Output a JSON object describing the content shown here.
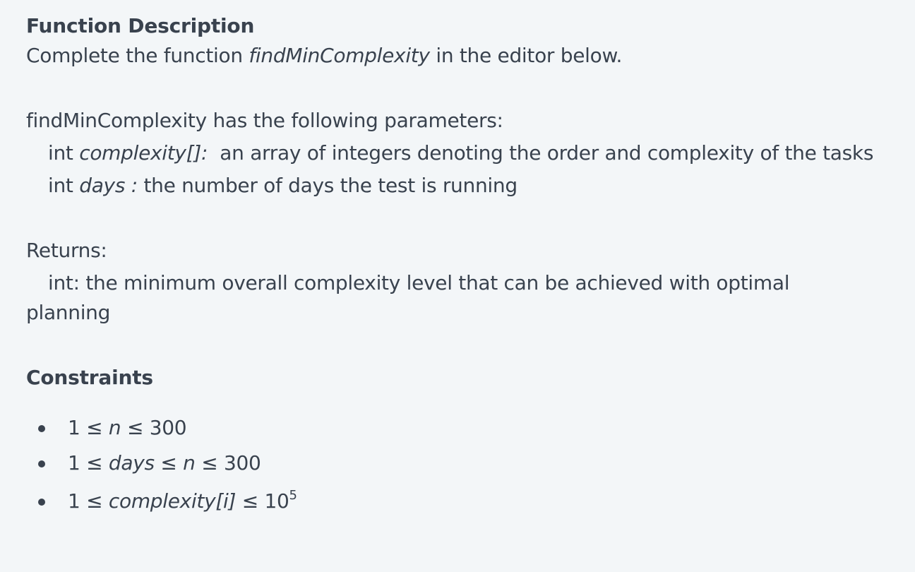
{
  "function_description": {
    "heading": "Function Description",
    "complete_pre": "Complete the function ",
    "function_name": "findMinComplexity",
    "complete_post": " in the editor below."
  },
  "parameters": {
    "intro": "findMinComplexity has the following parameters:",
    "items": [
      {
        "type": "int ",
        "name": "complexity[]:",
        "desc": "  an array of integers denoting the order and complexity of the tasks"
      },
      {
        "type": "int ",
        "name": "days :",
        "desc": " the number of days the test is running"
      }
    ]
  },
  "returns": {
    "label": "Returns:",
    "line1": "int: the minimum overall complexity level that can be achieved with optimal",
    "line2": "planning"
  },
  "constraints": {
    "heading": "Constraints",
    "items": [
      {
        "pre": "1 ≤ ",
        "var": "n",
        "post": " ≤ 300"
      },
      {
        "pre": "1 ≤ ",
        "var": "days",
        "mid": " ≤ ",
        "var2": "n",
        "post": " ≤ 300"
      },
      {
        "pre": "1 ≤ ",
        "var": "complexity[i]",
        "post": " ≤ 10",
        "sup": "5"
      }
    ]
  }
}
